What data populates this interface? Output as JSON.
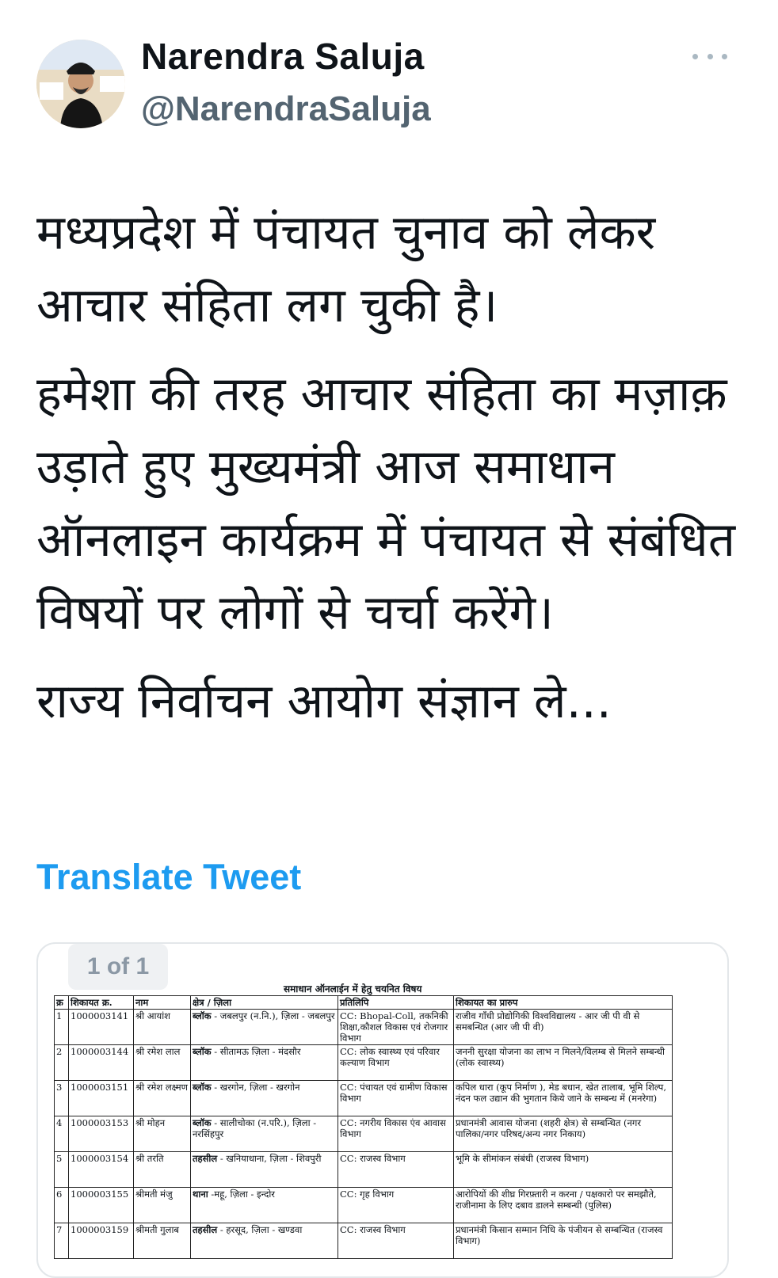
{
  "author": {
    "display_name": "Narendra Saluja",
    "handle": "@NarendraSaluja",
    "avatar_icon": "profile-photo"
  },
  "tweet": {
    "paragraphs": [
      "मध्यप्रदेश में पंचायत चुनाव को लेकर आचार संहिता लग चुकी है।",
      "हमेशा की तरह आचार संहिता का मज़ाक़ उड़ाते हुए मुख्यमंत्री आज समाधान ऑनलाइन कार्यक्रम में पंचायत से संबंधित विषयों पर लोगों से चर्चा करेंगे।",
      "राज्य निर्वाचन आयोग संज्ञान ले..."
    ],
    "translate_label": "Translate Tweet"
  },
  "media": {
    "page_indicator": "1 of 1",
    "document": {
      "title": "समाधान ऑनलाईन में हेतु चयनित विषय",
      "headers": [
        "क्र",
        "शिकायत क्र.",
        "नाम",
        "क्षेत्र / ज़िला",
        "प्रतिलिपि",
        "शिकायत का प्रारुप"
      ],
      "rows": [
        {
          "sn": "1",
          "id": "1000003141",
          "name": "श्री आयांश",
          "area_type": "ब्लॉक",
          "area": " - जबलपुर (न.नि.), ज़िला - जबलपुर",
          "cc": "CC: Bhopal-Coll, तकनिकी शिक्षा,कौशल विकास एवं रोजगार विभाग",
          "complaint": "राजीव गाँधी प्रोद्योगिकी विश्वविद्यालय - आर जी पी वी से समबन्धित (आर जी पी वी)"
        },
        {
          "sn": "2",
          "id": "1000003144",
          "name": "श्री रमेश लाल",
          "area_type": "ब्लॉक",
          "area": " - सीतामऊ ज़िला - मंदसौर",
          "cc": "CC: लोक स्वास्थ्य एवं परिवार कल्याण विभाग",
          "complaint": "जननी सुरक्षा योजना का लाभ न मिलने/विलम्ब से मिलने सम्बन्धी (लोक स्वास्थ्य)"
        },
        {
          "sn": "3",
          "id": "1000003151",
          "name": "श्री रमेश लक्ष्मण",
          "area_type": "ब्लॉक",
          "area": " - खरगोन, ज़िला - खरगोन",
          "cc": "CC: पंचायत एवं ग्रामीण विकास विभाग",
          "complaint": "कपिल धारा (कूप निर्माण ), मेड बधान, खेत तालाब, भूमि शिल्प, नंदन फल उद्यान की भुगतान किये जाने के सम्बन्ध में (मनरेगा)"
        },
        {
          "sn": "4",
          "id": "1000003153",
          "name": "श्री मोहन",
          "area_type": "ब्लॉक",
          "area": " - सालीचोका (न.परि.), ज़िला - नरसिंहपुर",
          "cc": "CC: नगरीय विकास एंव आवास विभाग",
          "complaint": "प्रधानमंत्री आवास योजना (शहरी क्षेत्र) से सम्बन्धित (नगर पालिका/नगर परिषद/अन्य नगर निकाय)"
        },
        {
          "sn": "5",
          "id": "1000003154",
          "name": "श्री तरति",
          "area_type": "तहसील",
          "area": " - खनियाधाना, ज़िला - शिवपुरी",
          "cc": "CC: राजस्व विभाग",
          "complaint": "भूमि के सीमांकन संबंधी (राजस्व विभाग)"
        },
        {
          "sn": "6",
          "id": "1000003155",
          "name": "श्रीमती मंजु",
          "area_type": "थाना",
          "area": " -महू, ज़िला - इन्दोर",
          "cc": "CC: गृह विभाग",
          "complaint": "आरोपियों की शीघ्र गिरफ़्तारी न करना / पक्षकारो पर समझौते, राजीनामा के लिए दबाव डालने सम्बन्धी (पुलिस)"
        },
        {
          "sn": "7",
          "id": "1000003159",
          "name": "श्रीमती गुलाब",
          "area_type": "तहसील",
          "area": " - हरसूद, ज़िला - खण्डवा",
          "cc": "CC: राजस्व विभाग",
          "complaint": "प्रधानमंत्री किसान सम्मान निधि के पंजीयन से सम्बन्धित (राजस्व विभाग)"
        }
      ]
    }
  },
  "colors": {
    "link": "#1d9bf0",
    "secondary_text": "#536471",
    "text": "#0f1419"
  }
}
